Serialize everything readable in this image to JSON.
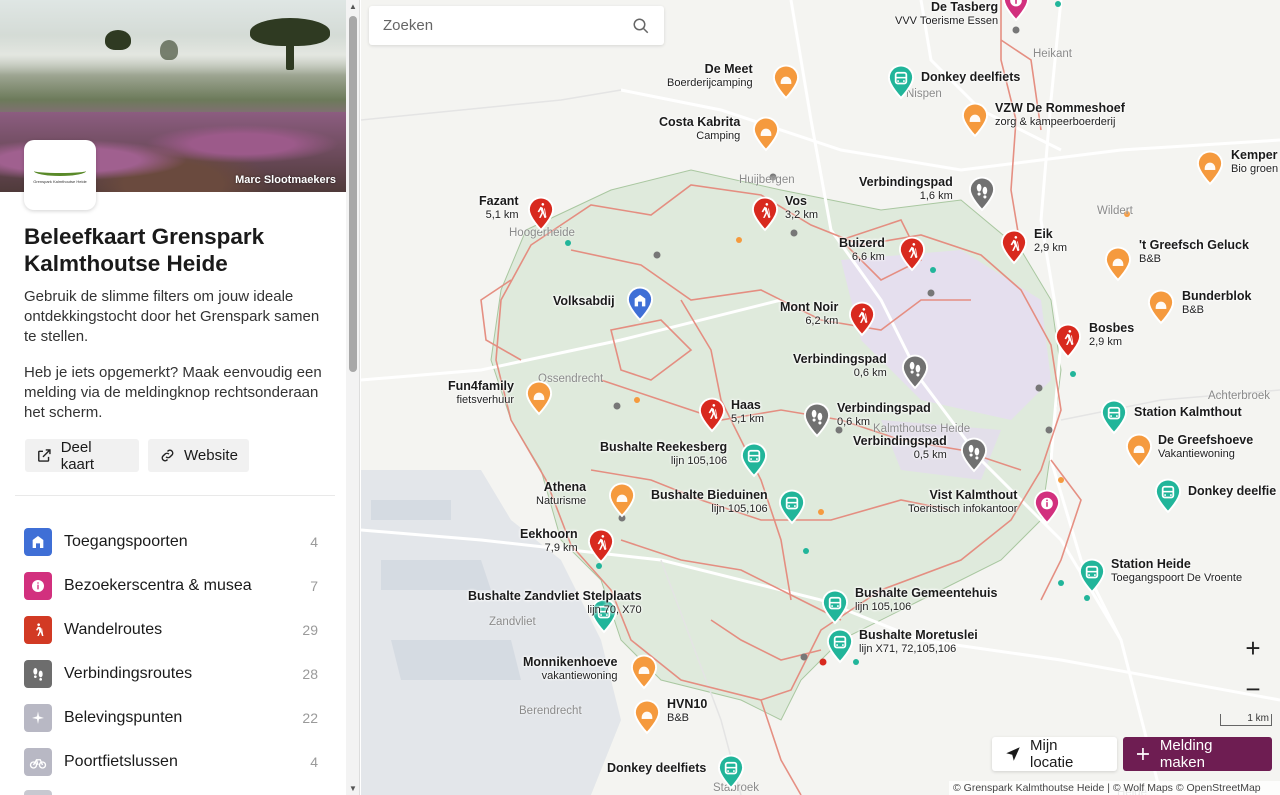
{
  "sidebar": {
    "photo_credit": "Marc Slootmaekers",
    "logo_text": "Grenspark Kalmthoutse Heide",
    "title": "Beleefkaart Grenspark Kalmthoutse Heide",
    "description_1": "Gebruik de slimme filters om jouw ideale ontdekkingstocht door het Grenspark samen te stellen.",
    "description_2": "Heb je iets opgemerkt? Maak eenvoudig een melding via de meldingknop rechtsonderaan het scherm.",
    "share_label": "Deel kaart",
    "website_label": "Website",
    "categories": [
      {
        "label": "Toegangspoorten",
        "count": "4",
        "color": "#3f6fd6",
        "icon": "gate-icon"
      },
      {
        "label": "Bezoekerscentra & musea",
        "count": "7",
        "color": "#d2307e",
        "icon": "info-icon"
      },
      {
        "label": "Wandelroutes",
        "count": "29",
        "color": "#d23a24",
        "icon": "hiker-icon"
      },
      {
        "label": "Verbindingsroutes",
        "count": "28",
        "color": "#6d6d6d",
        "icon": "footprints-icon"
      },
      {
        "label": "Belevingspunten",
        "count": "22",
        "color": "#b8b8c4",
        "icon": "sparkle-icon"
      },
      {
        "label": "Poortfietslussen",
        "count": "4",
        "color": "#b8b8c4",
        "icon": "bike-icon"
      }
    ]
  },
  "search": {
    "placeholder": "Zoeken"
  },
  "map": {
    "colors": {
      "hike": "#d8291e",
      "connect": "#717171",
      "stay": "#f59a3e",
      "transit": "#21b59a",
      "info": "#d2307e",
      "gate": "#3f6fd6"
    },
    "place_names": [
      "Heikant",
      "Kalmthoutse Heide",
      "Huijbergen",
      "Hoogerheide",
      "Achterbroek",
      "Ossendrecht",
      "Zandvliet",
      "Berendrecht",
      "Stabroek",
      "Wildert",
      "Nispen",
      "Heide"
    ],
    "pois": [
      {
        "name": "De Tasberg",
        "sub": "VVV Toerisme Essen",
        "type": "info"
      },
      {
        "name": "De Meet",
        "sub": "Boerderijcamping",
        "type": "stay"
      },
      {
        "name": "Donkey deelfiets",
        "sub": "",
        "type": "transit"
      },
      {
        "name": "VZW De Rommeshoef",
        "sub": "zorg & kampeerboerderij",
        "type": "stay"
      },
      {
        "name": "Costa Kabrita",
        "sub": "Camping",
        "type": "stay"
      },
      {
        "name": "Kemper",
        "sub": "Bio groen",
        "type": "stay"
      },
      {
        "name": "Verbindingspad",
        "sub": "1,6 km",
        "type": "connect"
      },
      {
        "name": "Fazant",
        "sub": "5,1 km",
        "type": "hike"
      },
      {
        "name": "Vos",
        "sub": "3,2 km",
        "type": "hike"
      },
      {
        "name": "Buizerd",
        "sub": "6,6 km",
        "type": "hike"
      },
      {
        "name": "Eik",
        "sub": "2,9 km",
        "type": "hike"
      },
      {
        "name": "'t Greefsch Geluck",
        "sub": "B&B",
        "type": "stay"
      },
      {
        "name": "Bunderblok",
        "sub": "B&B",
        "type": "stay"
      },
      {
        "name": "Volksabdij",
        "sub": "",
        "type": "gate"
      },
      {
        "name": "Mont Noir",
        "sub": "6,2 km",
        "type": "hike"
      },
      {
        "name": "Bosbes",
        "sub": "2,9 km",
        "type": "hike"
      },
      {
        "name": "Verbindingspad",
        "sub": "0,6 km",
        "type": "connect"
      },
      {
        "name": "Fun4family",
        "sub": "fietsverhuur",
        "type": "stay"
      },
      {
        "name": "Haas",
        "sub": "5,1 km",
        "type": "hike"
      },
      {
        "name": "Verbindingspad",
        "sub": "0,6 km",
        "type": "connect"
      },
      {
        "name": "Station Kalmthout",
        "sub": "",
        "type": "transit"
      },
      {
        "name": "Bushalte Reekesberg",
        "sub": "lijn 105,106",
        "type": "transit"
      },
      {
        "name": "Verbindingspad",
        "sub": "0,5 km",
        "type": "connect"
      },
      {
        "name": "De Greefshoeve",
        "sub": "Vakantiewoning",
        "type": "stay"
      },
      {
        "name": "Athena",
        "sub": "Naturisme",
        "type": "stay"
      },
      {
        "name": "Bushalte Bieduinen",
        "sub": "lijn 105,106",
        "type": "transit"
      },
      {
        "name": "Vist Kalmthout",
        "sub": "Toeristisch infokantoor",
        "type": "info"
      },
      {
        "name": "Donkey deelfie",
        "sub": "",
        "type": "transit"
      },
      {
        "name": "Eekhoorn",
        "sub": "7,9 km",
        "type": "hike"
      },
      {
        "name": "Station Heide",
        "sub": "Toegangspoort De Vroente",
        "type": "transit"
      },
      {
        "name": "Bushalte Zandvliet Stelplaats",
        "sub": "lijn 70, X70",
        "type": "transit"
      },
      {
        "name": "Bushalte Gemeentehuis",
        "sub": "lijn 105,106",
        "type": "transit"
      },
      {
        "name": "Bushalte Moretuslei",
        "sub": "lijn X71, 72,105,106",
        "type": "transit"
      },
      {
        "name": "Monnikenhoeve",
        "sub": "vakantiewoning",
        "type": "stay"
      },
      {
        "name": "HVN10",
        "sub": "B&B",
        "type": "stay"
      },
      {
        "name": "Donkey deelfiets",
        "sub": "",
        "type": "transit"
      }
    ],
    "scale_label": "1 km",
    "attribution": "© Grenspark Kalmthoutse Heide | © Wolf Maps © OpenStreetMap"
  },
  "controls": {
    "location_label": "Mijn locatie",
    "report_label": "Melding maken"
  }
}
